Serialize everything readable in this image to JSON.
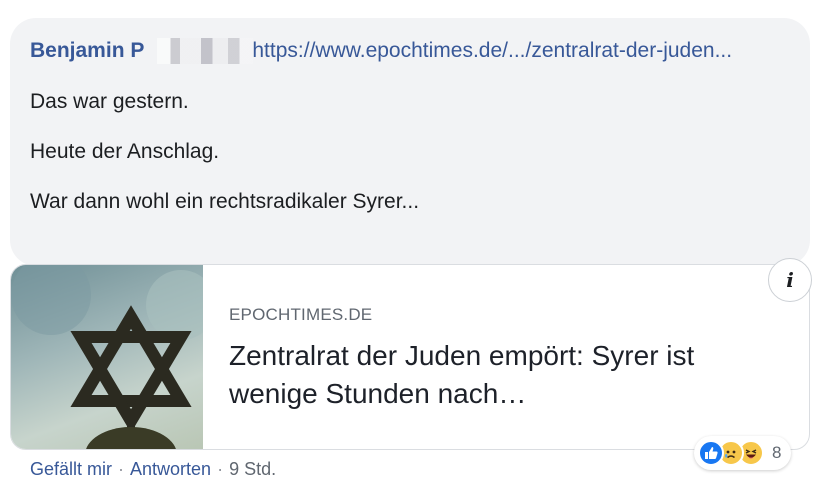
{
  "comment": {
    "author": "Benjamin P",
    "link_text": "https://www.epochtimes.de/.../zentralrat-der-juden...",
    "paragraphs": [
      "Das war gestern.",
      "Heute der Anschlag.",
      "War dann wohl ein rechtsradikaler Syrer..."
    ]
  },
  "link_preview": {
    "domain": "EPOCHTIMES.DE",
    "headline": "Zentralrat der Juden empört: Syrer ist wenige Stunden nach…",
    "info_icon": "info-icon"
  },
  "actions": {
    "like": "Gefällt mir",
    "reply": "Antworten",
    "separator": "·",
    "time": "9 Std."
  },
  "reactions": {
    "icons": [
      "like-icon",
      "sad-icon",
      "haha-icon"
    ],
    "count": "8"
  },
  "colors": {
    "link": "#385898",
    "bubble": "#f2f3f5",
    "like": "#1877f2",
    "emoji": "#f7c74a"
  }
}
